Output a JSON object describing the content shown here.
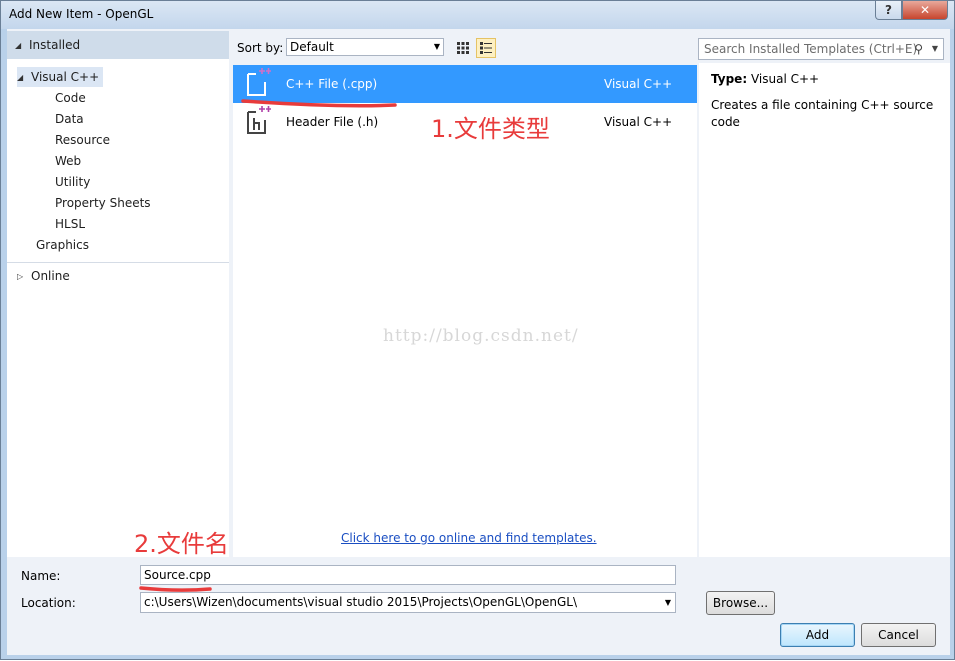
{
  "window": {
    "title": "Add New Item - OpenGL",
    "help_label": "?",
    "close_label": "✕"
  },
  "left_panel": {
    "installed_label": "Installed",
    "tree": [
      {
        "label": "Visual C++",
        "level": 0,
        "expanded": true,
        "selected": true
      },
      {
        "label": "Code",
        "level": 1
      },
      {
        "label": "Data",
        "level": 1
      },
      {
        "label": "Resource",
        "level": 1
      },
      {
        "label": "Web",
        "level": 1
      },
      {
        "label": "Utility",
        "level": 1
      },
      {
        "label": "Property Sheets",
        "level": 1
      },
      {
        "label": "HLSL",
        "level": 1
      },
      {
        "label": "Graphics",
        "level": 0
      }
    ],
    "online_label": "Online"
  },
  "toolbar": {
    "sort_label": "Sort by:",
    "sort_value": "Default",
    "search_placeholder": "Search Installed Templates (Ctrl+E)"
  },
  "templates": [
    {
      "name": "C++ File (.cpp)",
      "category": "Visual C++",
      "selected": true
    },
    {
      "name": "Header File (.h)",
      "category": "Visual C++",
      "selected": false
    }
  ],
  "watermark": "http://blog.csdn.net/",
  "online_link": "Click here to go online and find templates.",
  "details": {
    "type_label": "Type:",
    "type_value": "Visual C++",
    "description": "Creates a file containing C++ source code"
  },
  "annotations": {
    "file_type": "1.文件类型",
    "file_name": "2.文件名",
    "color": "#e83b3b"
  },
  "form": {
    "name_label": "Name:",
    "name_value": "Source.cpp",
    "location_label": "Location:",
    "location_value": "c:\\Users\\Wizen\\documents\\visual studio 2015\\Projects\\OpenGL\\OpenGL\\",
    "browse_label": "Browse...",
    "add_label": "Add",
    "cancel_label": "Cancel"
  },
  "colors": {
    "selection": "#3399ff",
    "link": "#1a4ec2",
    "frame": "#b9d1ea"
  }
}
